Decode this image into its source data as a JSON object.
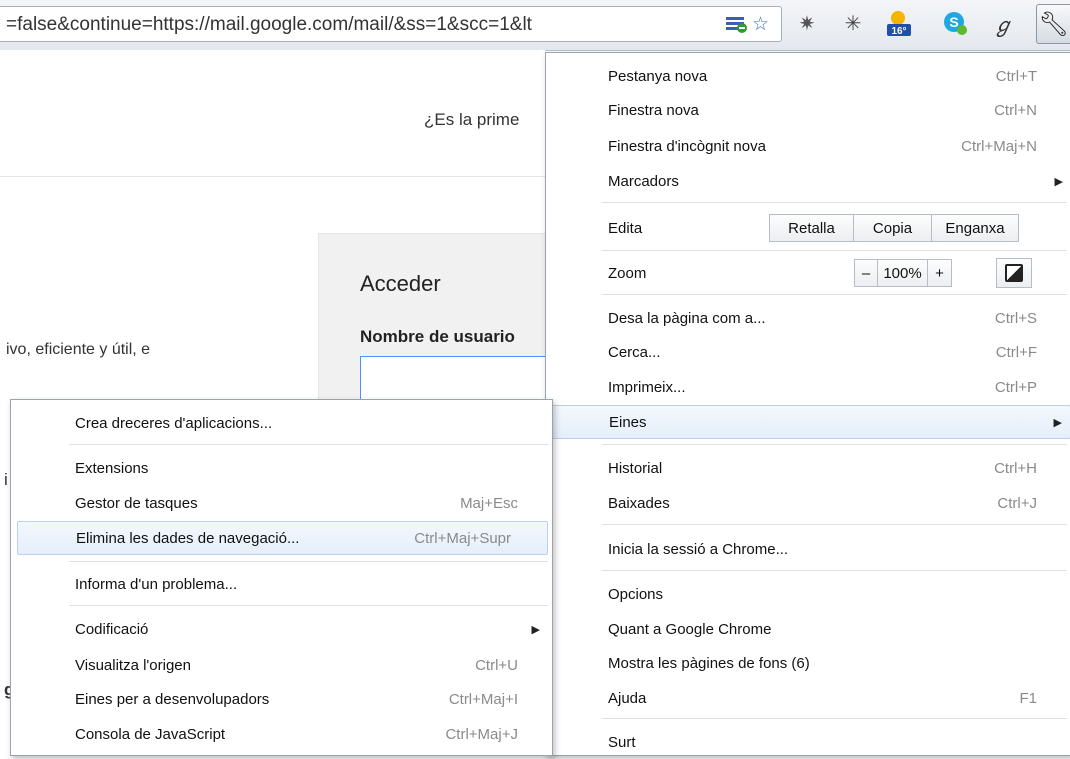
{
  "browser": {
    "url": "=false&continue=https://mail.google.com/mail/&ss=1&scc=1&lt",
    "weather_temp": "16°"
  },
  "page": {
    "question_fragment": "¿Es la prime",
    "signin_title": "Acceder",
    "username_label": "Nombre de usuario",
    "tagline_fragment": "ivo, eficiente y útil, e",
    "left_fragment_1": "i",
    "left_fragment_2": "g"
  },
  "main_menu": {
    "new_tab": {
      "label": "Pestanya nova",
      "shortcut": "Ctrl+T"
    },
    "new_window": {
      "label": "Finestra nova",
      "shortcut": "Ctrl+N"
    },
    "new_incognito": {
      "label": "Finestra d'incògnit nova",
      "shortcut": "Ctrl+Maj+N"
    },
    "bookmarks": {
      "label": "Marcadors"
    },
    "edit": {
      "label": "Edita",
      "cut": "Retalla",
      "copy": "Copia",
      "paste": "Enganxa"
    },
    "zoom": {
      "label": "Zoom",
      "minus": "–",
      "level": "100%",
      "plus": "+"
    },
    "save_page": {
      "label": "Desa la pàgina com a...",
      "shortcut": "Ctrl+S"
    },
    "find": {
      "label": "Cerca...",
      "shortcut": "Ctrl+F"
    },
    "print": {
      "label": "Imprimeix...",
      "shortcut": "Ctrl+P"
    },
    "tools": {
      "label": "Eines"
    },
    "history": {
      "label": "Historial",
      "shortcut": "Ctrl+H"
    },
    "downloads": {
      "label": "Baixades",
      "shortcut": "Ctrl+J"
    },
    "sign_in": {
      "label": "Inicia la sessió a Chrome..."
    },
    "options": {
      "label": "Opcions"
    },
    "about": {
      "label": "Quant a Google Chrome"
    },
    "background_pages": {
      "label": "Mostra les pàgines de fons (6)"
    },
    "help": {
      "label": "Ajuda",
      "shortcut": "F1"
    },
    "exit": {
      "label": "Surt"
    }
  },
  "tools_submenu": {
    "create_shortcuts": {
      "label": "Crea dreceres d'aplicacions..."
    },
    "extensions": {
      "label": "Extensions"
    },
    "task_manager": {
      "label": "Gestor de tasques",
      "shortcut": "Maj+Esc"
    },
    "clear_data": {
      "label": "Elimina les dades de navegació...",
      "shortcut": "Ctrl+Maj+Supr"
    },
    "report_issue": {
      "label": "Informa d'un problema..."
    },
    "encoding": {
      "label": "Codificació"
    },
    "view_source": {
      "label": "Visualitza l'origen",
      "shortcut": "Ctrl+U"
    },
    "dev_tools": {
      "label": "Eines per a desenvolupadors",
      "shortcut": "Ctrl+Maj+I"
    },
    "js_console": {
      "label": "Consola de JavaScript",
      "shortcut": "Ctrl+Maj+J"
    }
  },
  "colors": {
    "hover_bg": "#e5eefa",
    "hover_border": "#b9d0ee",
    "shortcut_text": "#8a8a8a"
  }
}
